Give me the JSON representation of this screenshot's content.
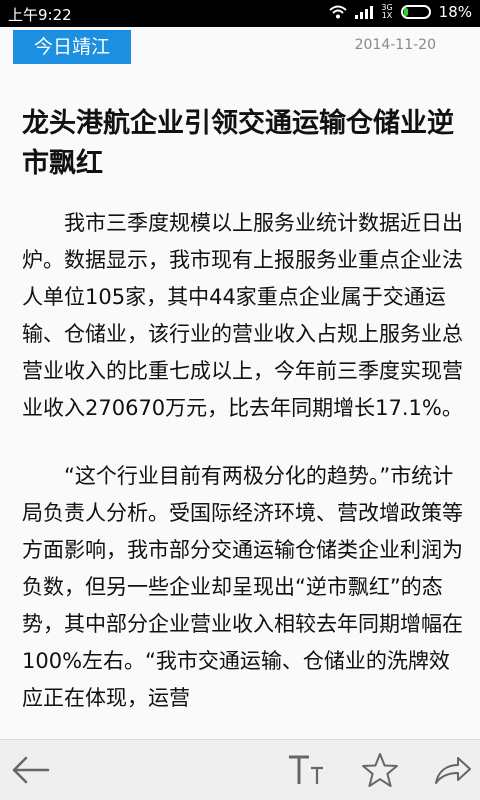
{
  "status_bar": {
    "time": "上午9:22",
    "network": "3G",
    "network_sub": "1X",
    "battery_percent_text": "18%",
    "battery_level": 0.18,
    "battery_color": "#2fd12f"
  },
  "header": {
    "source_label": "今日靖江",
    "date": "2014-11-20",
    "accent_color": "#1d8fe1"
  },
  "article": {
    "title": "龙头港航企业引领交通运输仓储业逆市飘红",
    "paragraphs": [
      "我市三季度规模以上服务业统计数据近日出炉。数据显示，我市现有上报服务业重点企业法人单位105家，其中44家重点企业属于交通运输、仓储业，该行业的营业收入占规上服务业总营业收入的比重七成以上，今年前三季度实现营业收入270670万元，比去年同期增长17.1%。",
      "“这个行业目前有两极分化的趋势。”市统计局负责人分析。受国际经济环境、营改增政策等方面影响，我市部分交通运输仓储类企业利润为负数，但另一些企业却呈现出“逆市飘红”的态势，其中部分企业营业收入相较去年同期增幅在100%左右。“我市交通运输、仓储业的洗牌效应正在体现，运营"
    ]
  },
  "toolbar": {
    "icons": [
      "back-arrow-icon",
      "font-size-icon",
      "star-icon",
      "share-icon"
    ]
  }
}
